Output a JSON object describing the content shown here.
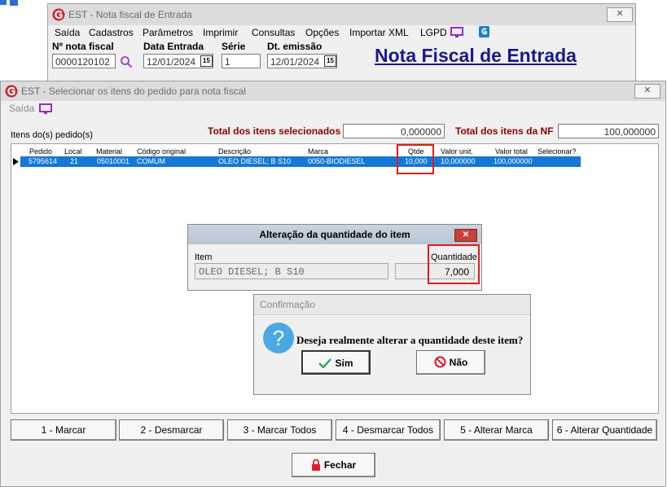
{
  "back_window": {
    "title": "EST - Nota fiscal de Entrada",
    "close": "✕",
    "menu": [
      "Saída",
      "Cadastros",
      "Parâmetros",
      "Imprimir",
      "Consultas",
      "Opções",
      "Importar XML",
      "LGPD"
    ],
    "fields": {
      "nota_label": "Nº nota fiscal",
      "nota_value": "0000120102",
      "data_label": "Data Entrada",
      "data_value": "12/01/2024",
      "serie_label": "Série",
      "serie_value": "1",
      "emissao_label": "Dt. emissão",
      "emissao_value": "12/01/2024",
      "cal_icon": "15"
    },
    "big_title": "Nota Fiscal de Entrada"
  },
  "main_window": {
    "title": "EST - Selecionar os itens do pedido para nota fiscal",
    "close": "✕",
    "menu_saida": "Saída",
    "grid_label": "Itens do(s) pedido(s)",
    "total_sel_label": "Total dos itens selecionados",
    "total_sel_value": "0,000000",
    "total_nf_label": "Total dos itens da NF",
    "total_nf_value": "100,000000",
    "columns": [
      "Pedido",
      "Local",
      "Material",
      "Código original",
      "Descrição",
      "Marca",
      "Qtde",
      "Valor unit.",
      "Valor total",
      "Selecionar?"
    ],
    "row": {
      "pedido": "5795614",
      "local": "21",
      "material": "05010001",
      "codigo": "COMUM",
      "descricao": "OLEO DIESEL; B S10",
      "marca": "0050-BIODIESEL",
      "qtde": "10,000",
      "valor_unit": "10,000000",
      "valor_total": "100,000000",
      "selecionar": ""
    },
    "buttons": {
      "marcar": "1 - Marcar",
      "desmarcar": "2 - Desmarcar",
      "marcar_todos": "3 - Marcar Todos",
      "desmarcar_todos": "4 - Desmarcar Todos",
      "alterar_marca": "5 - Alterar Marca",
      "alterar_qtd": "6 - Alterar Quantidade",
      "fechar": "Fechar"
    }
  },
  "qty_dialog": {
    "title": "Alteração da quantidade do item",
    "close": "✕",
    "item_label": "Item",
    "item_value": "OLEO DIESEL; B S10",
    "qty_label": "Quantidade",
    "qty_value": "7,000"
  },
  "confirm_dialog": {
    "title": "Confirmação",
    "message": "Deseja realmente alterar a quantidade deste item?",
    "yes": "Sim",
    "no": "Não",
    "question_glyph": "?"
  },
  "colors": {
    "selection": "#1479d6",
    "highlight": "#e31b1b",
    "title_blue": "#1a1a8c",
    "lgpd_icon": "#9b2ac8"
  }
}
